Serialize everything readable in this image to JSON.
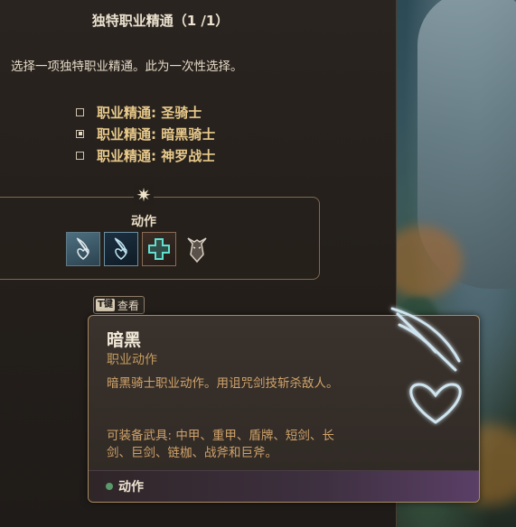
{
  "header": {
    "title": "独特职业精通（1 /1）"
  },
  "instruction": "选择一项独特职业精通。此为一次性选择。",
  "options": [
    {
      "label": "职业精通: 圣骑士",
      "selected": false
    },
    {
      "label": "职业精通: 暗黑骑士",
      "selected": true
    },
    {
      "label": "职业精通: 神罗战士",
      "selected": false
    }
  ],
  "actions": {
    "label": "动作",
    "icons": [
      "heart-slash-icon",
      "heart-slash-selected-icon",
      "healing-cross-icon",
      "beast-head-icon"
    ]
  },
  "hint": {
    "key": "T键",
    "label": "查看"
  },
  "tooltip": {
    "name": "暗黑",
    "type": "职业动作",
    "description": "暗黑骑士职业动作。用诅咒剑技斩杀敌人。",
    "equipment": "可装备武具: 中甲、重甲、盾牌、短剑、长剑、巨剑、链枷、战斧和巨斧。",
    "footer_label": "动作"
  },
  "colors": {
    "gold_text": "#e8c98a",
    "tooltip_text": "#d1a36a",
    "footer_dot": "#5a9a6a"
  }
}
